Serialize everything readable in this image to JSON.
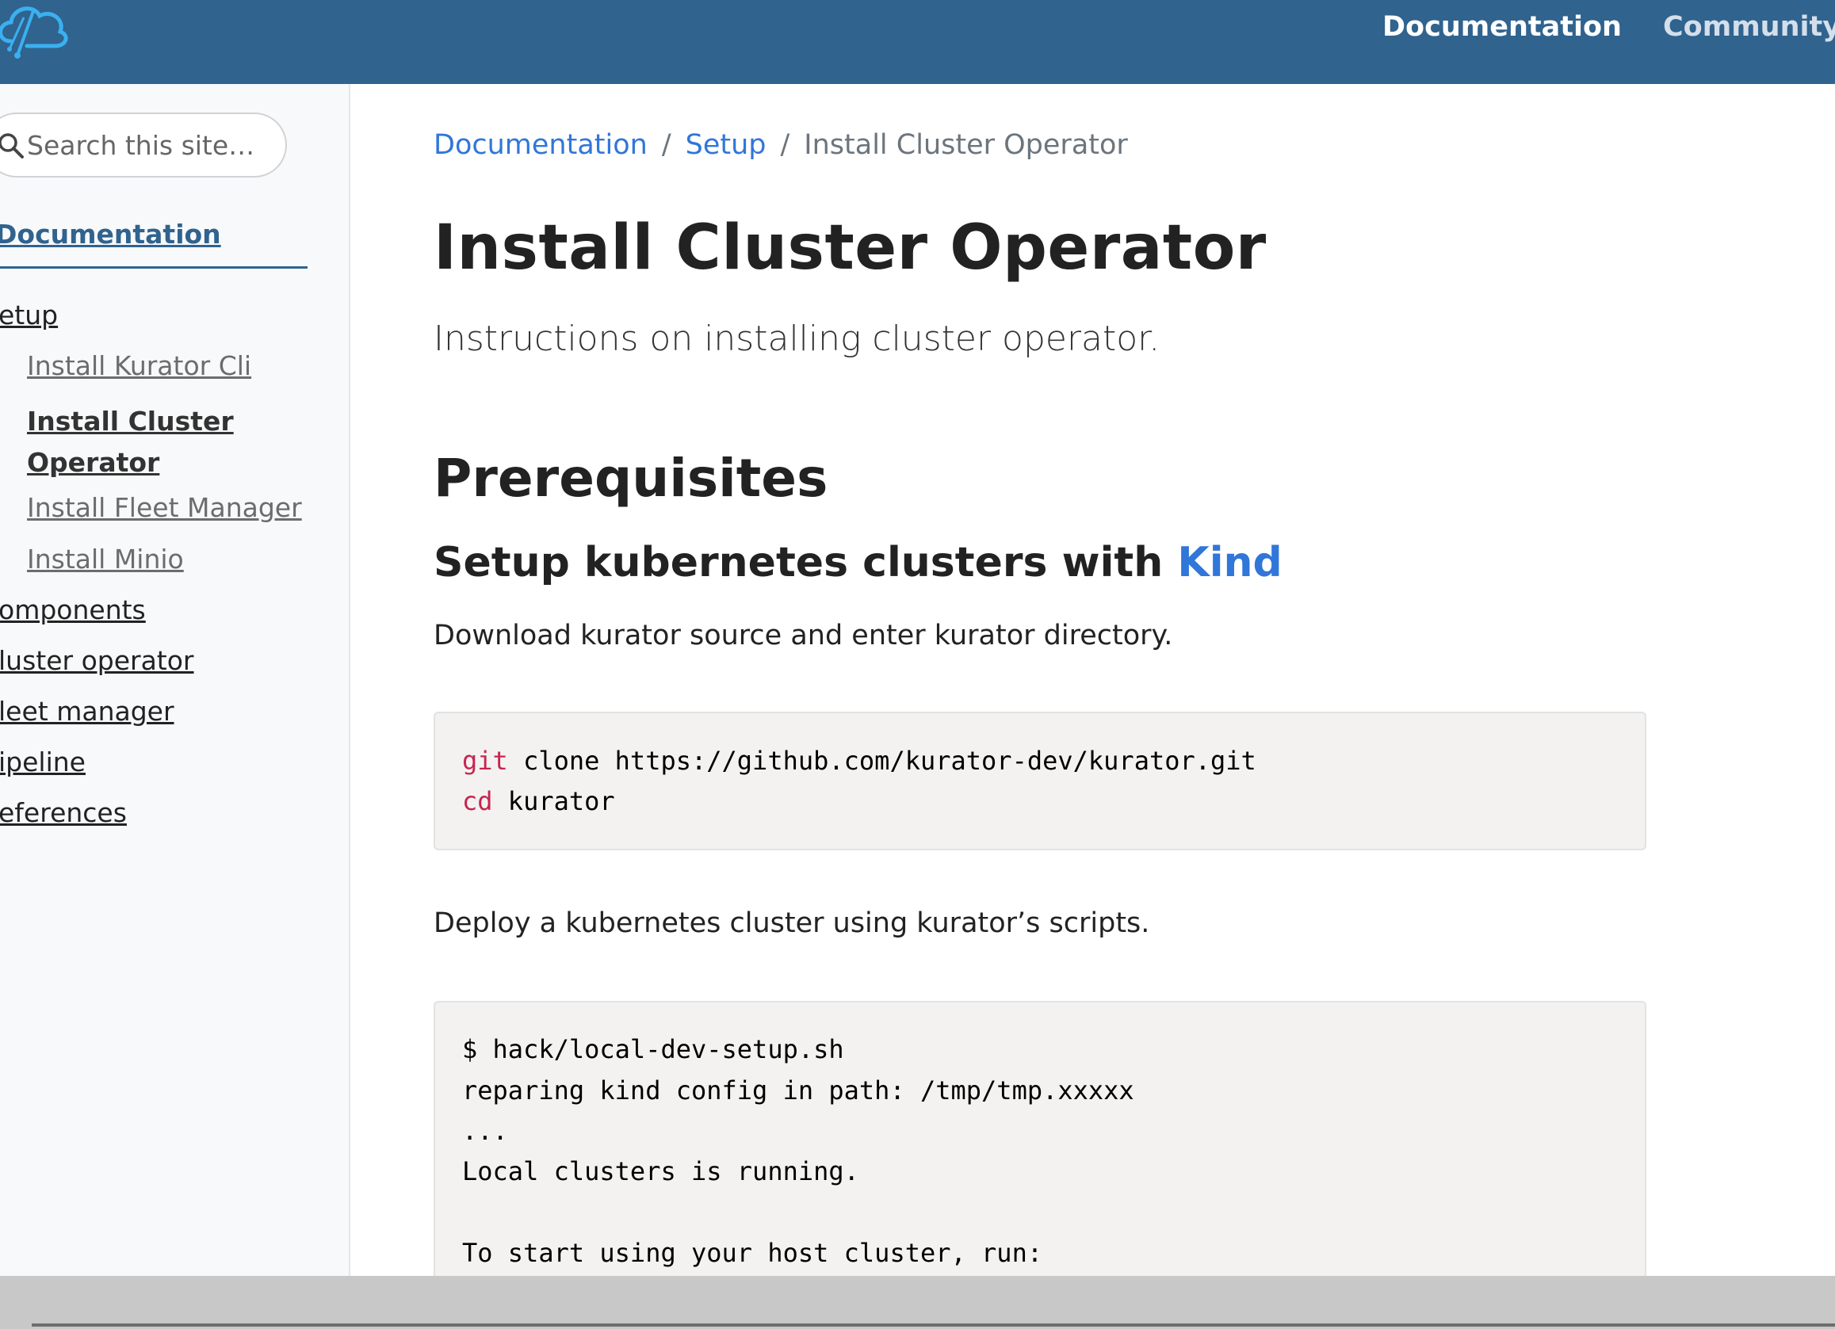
{
  "header": {
    "nav": [
      {
        "label": "Documentation"
      },
      {
        "label": "Community"
      }
    ]
  },
  "sidebar": {
    "search_placeholder": "Search this site…",
    "section_title": "Documentation",
    "items": [
      {
        "label": "etup"
      },
      {
        "label": "Install Kurator Cli"
      },
      {
        "label": "Install Cluster Operator"
      },
      {
        "label": "Install Fleet Manager"
      },
      {
        "label": "Install Minio"
      },
      {
        "label": "omponents"
      },
      {
        "label": "luster operator"
      },
      {
        "label": "leet manager"
      },
      {
        "label": "ipeline"
      },
      {
        "label": "eferences"
      }
    ]
  },
  "breadcrumb": {
    "items": [
      "Documentation",
      "Setup",
      "Install Cluster Operator"
    ],
    "separator": "/"
  },
  "page": {
    "title": "Install Cluster Operator",
    "lead": "Instructions on installing cluster operator.",
    "h2": "Prerequisites",
    "h3_text": "Setup kubernetes clusters with ",
    "h3_link": "Kind",
    "p1": "Download kurator source and enter kurator directory.",
    "p2": "Deploy a kubernetes cluster using kurator’s scripts."
  },
  "code1": {
    "lines": [
      {
        "kw": "git",
        "rest": " clone https://github.com/kurator-dev/kurator.git"
      },
      {
        "kw": "cd",
        "rest": " kurator"
      }
    ]
  },
  "code2": {
    "lines": [
      "$ hack/local-dev-setup.sh",
      "reparing kind config in path: /tmp/tmp.xxxxx",
      "...",
      "Local clusters is running.",
      "",
      "To start using your host cluster, run:"
    ]
  },
  "colors": {
    "navbar": "#30638e",
    "link": "#3176d9",
    "code_keyword": "#c7254e",
    "code_bg": "#f3f2f1"
  }
}
